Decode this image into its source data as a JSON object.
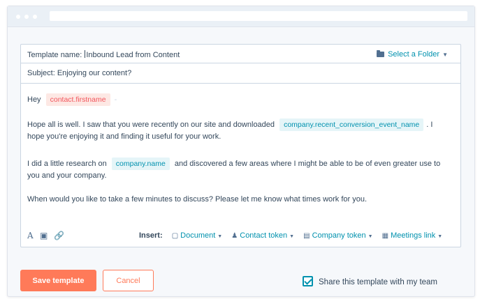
{
  "template_name": {
    "label": "Template name:",
    "value": "Inbound Lead from Content"
  },
  "folder": {
    "label": "Select a Folder",
    "icon": "folder-icon"
  },
  "subject": {
    "label": "Subject:",
    "value": "Enjoying our content?"
  },
  "body": {
    "greeting": "Hey",
    "token_firstname": "contact.firstname",
    "p1_a": "Hope all is well. I saw that you were recently on our site and downloaded",
    "token_conversion": "company.recent_conversion_event_name",
    "p1_b": ". I",
    "p1_c": "hope you're enjoying it and finding it useful for your work.",
    "p2_a": "I did a little research on",
    "token_company": "company.name",
    "p2_b": "and discovered a few areas where I might be able to be of even greater use to",
    "p2_c": "you and your company.",
    "p3": "When would you like to take a few minutes to discuss? Please let me know what times work for you."
  },
  "toolbar": {
    "icons": [
      "text-format-icon",
      "image-icon",
      "link-icon"
    ],
    "insert_label": "Insert:",
    "document": "Document",
    "contact_token": "Contact token",
    "company_token": "Company token",
    "meetings_link": "Meetings link"
  },
  "actions": {
    "save": "Save template",
    "cancel": "Cancel",
    "share": "Share this template with my team",
    "share_checked": true
  },
  "colors": {
    "accent": "#ff7a59",
    "link": "#0091ae",
    "text": "#33475b",
    "contact_token_bg": "#fde8e4",
    "company_token_bg": "#e5f5f8"
  }
}
